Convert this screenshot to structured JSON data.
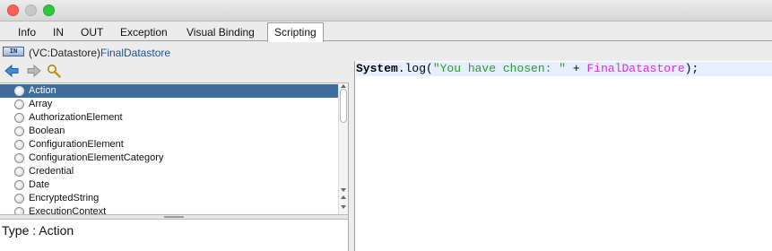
{
  "window": {
    "title": ""
  },
  "tabs": [
    {
      "label": "Info"
    },
    {
      "label": "IN"
    },
    {
      "label": "OUT"
    },
    {
      "label": "Exception"
    },
    {
      "label": "Visual Binding"
    },
    {
      "label": "Scripting",
      "active": true
    }
  ],
  "context": {
    "badge": "IN",
    "type": "(VC:Datastore)",
    "name": "FinalDatastore"
  },
  "navigation": {
    "icons": [
      "back-arrow-icon",
      "forward-arrow-icon",
      "search-icon"
    ]
  },
  "type_list": {
    "selected": "Action",
    "items": [
      {
        "label": "Action"
      },
      {
        "label": "Array"
      },
      {
        "label": "AuthorizationElement"
      },
      {
        "label": "Boolean"
      },
      {
        "label": "ConfigurationElement"
      },
      {
        "label": "ConfigurationElementCategory"
      },
      {
        "label": "Credential"
      },
      {
        "label": "Date"
      },
      {
        "label": "EncryptedString"
      },
      {
        "label": "ExecutionContext"
      }
    ]
  },
  "type_detail": {
    "label": "Type : Action"
  },
  "editor": {
    "code": {
      "object": "System",
      "call": ".log(",
      "string": "\"You have chosen: \"",
      "operator": " + ",
      "variable": "FinalDatastore",
      "end": ");"
    }
  },
  "colors": {
    "selection": "#3e6d9b",
    "string": "#2b9a2b",
    "variable": "#e028e0",
    "link": "#1c4f91",
    "current_line": "#e6efff"
  }
}
